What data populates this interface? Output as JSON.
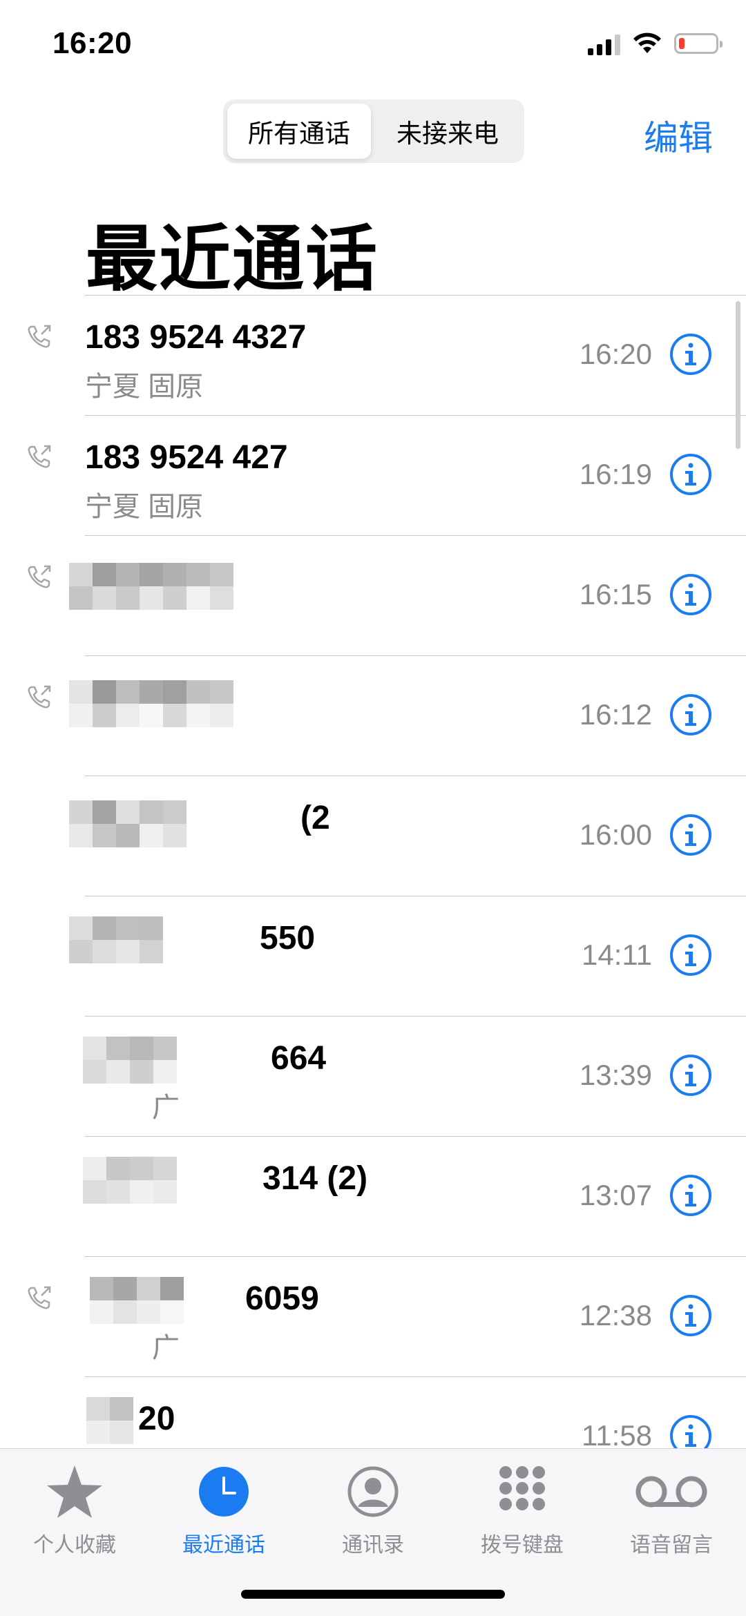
{
  "status_bar": {
    "time": "16:20",
    "battery_level": 0.12
  },
  "header": {
    "segments": [
      "所有通话",
      "未接来电"
    ],
    "selected_segment": "所有通话",
    "edit_label": "编辑",
    "title": "最近通话"
  },
  "calls": [
    {
      "number": "183 9524 4327",
      "location": "宁夏 固原",
      "time": "16:20",
      "outgoing": true
    },
    {
      "number": "183 9524 427",
      "location": "宁夏 固原",
      "time": "16:19",
      "outgoing": true
    },
    {
      "number": "",
      "location": "",
      "time": "16:15",
      "outgoing": true
    },
    {
      "number": "",
      "location": "",
      "time": "16:12",
      "outgoing": true
    },
    {
      "number": "(2",
      "location": "",
      "time": "16:00",
      "outgoing": false
    },
    {
      "number": "550",
      "location": "",
      "time": "14:11",
      "outgoing": false
    },
    {
      "number": "664",
      "location": "广",
      "time": "13:39",
      "outgoing": false
    },
    {
      "number": "314 (2)",
      "location": "",
      "time": "13:07",
      "outgoing": false
    },
    {
      "number": "6059",
      "location": "广",
      "time": "12:38",
      "outgoing": true
    },
    {
      "number": "20",
      "location": "",
      "time": "11:58",
      "outgoing": false
    }
  ],
  "tabs": [
    {
      "label": "个人收藏",
      "icon": "star-icon"
    },
    {
      "label": "最近通话",
      "icon": "clock-icon"
    },
    {
      "label": "通讯录",
      "icon": "contact-icon"
    },
    {
      "label": "拨号键盘",
      "icon": "keypad-icon"
    },
    {
      "label": "语音留言",
      "icon": "voicemail-icon"
    }
  ],
  "active_tab": "最近通话",
  "colors": {
    "accent": "#1a7cf0",
    "secondary_text": "#8a8a8e"
  }
}
